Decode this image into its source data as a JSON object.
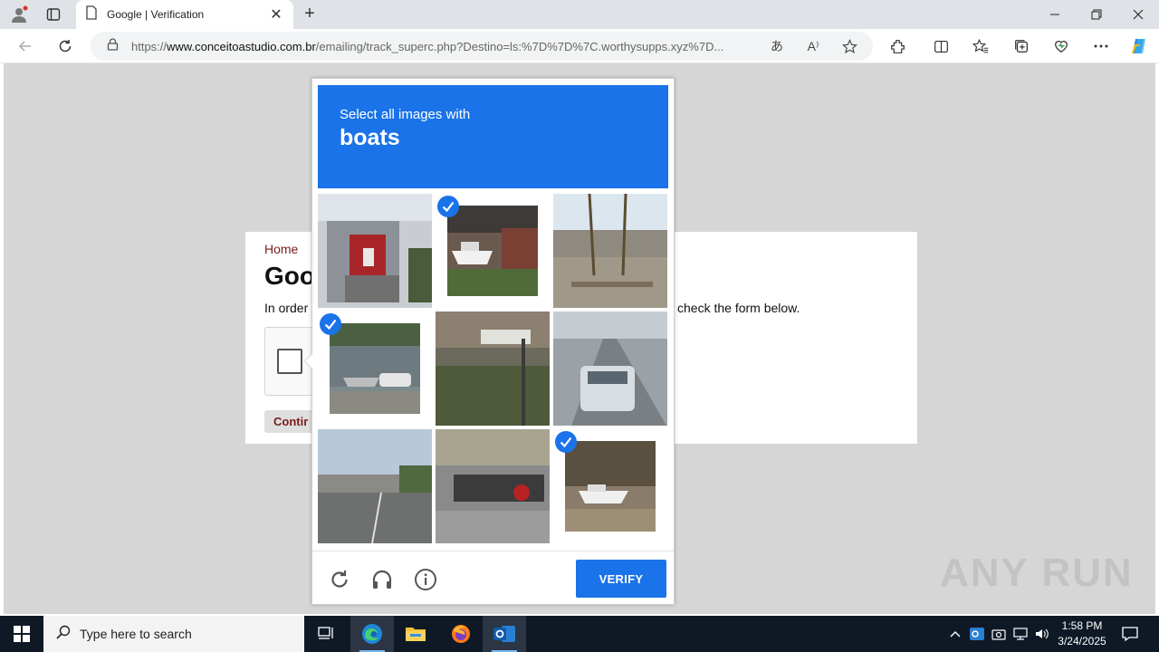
{
  "browser": {
    "tab_title": "Google | Verification",
    "url_prefix": "https://",
    "url_domain": "www.conceitoastudio.com.br",
    "url_path": "/emailing/track_superc.php?Destino=ls:%7D%7D%7C.worthysupps.xyz%7D..."
  },
  "page": {
    "breadcrumb_home": "Home",
    "heading": "Goo",
    "lead_start": "In order",
    "lead_end": "check the form below.",
    "continue_label": "Contir"
  },
  "captcha": {
    "instruction": "Select all images with",
    "target": "boats",
    "verify_label": "VERIFY",
    "tiles": [
      {
        "name": "building-entrance",
        "selected": false
      },
      {
        "name": "boat-by-house",
        "selected": true
      },
      {
        "name": "street-square",
        "selected": false
      },
      {
        "name": "boat-on-trailer-house",
        "selected": true
      },
      {
        "name": "street-sign-yard",
        "selected": false
      },
      {
        "name": "highway-car",
        "selected": false
      },
      {
        "name": "overpass-road",
        "selected": false
      },
      {
        "name": "parked-motorcycles",
        "selected": false
      },
      {
        "name": "boat-under-tree",
        "selected": true
      }
    ]
  },
  "watermark": "ANY RUN",
  "taskbar": {
    "search_placeholder": "Type here to search",
    "time": "1:58 PM",
    "date": "3/24/2025"
  },
  "colors": {
    "captcha_blue": "#1a73e8",
    "taskbar_bg": "#0f1926",
    "link_red": "#7a1c1c"
  }
}
